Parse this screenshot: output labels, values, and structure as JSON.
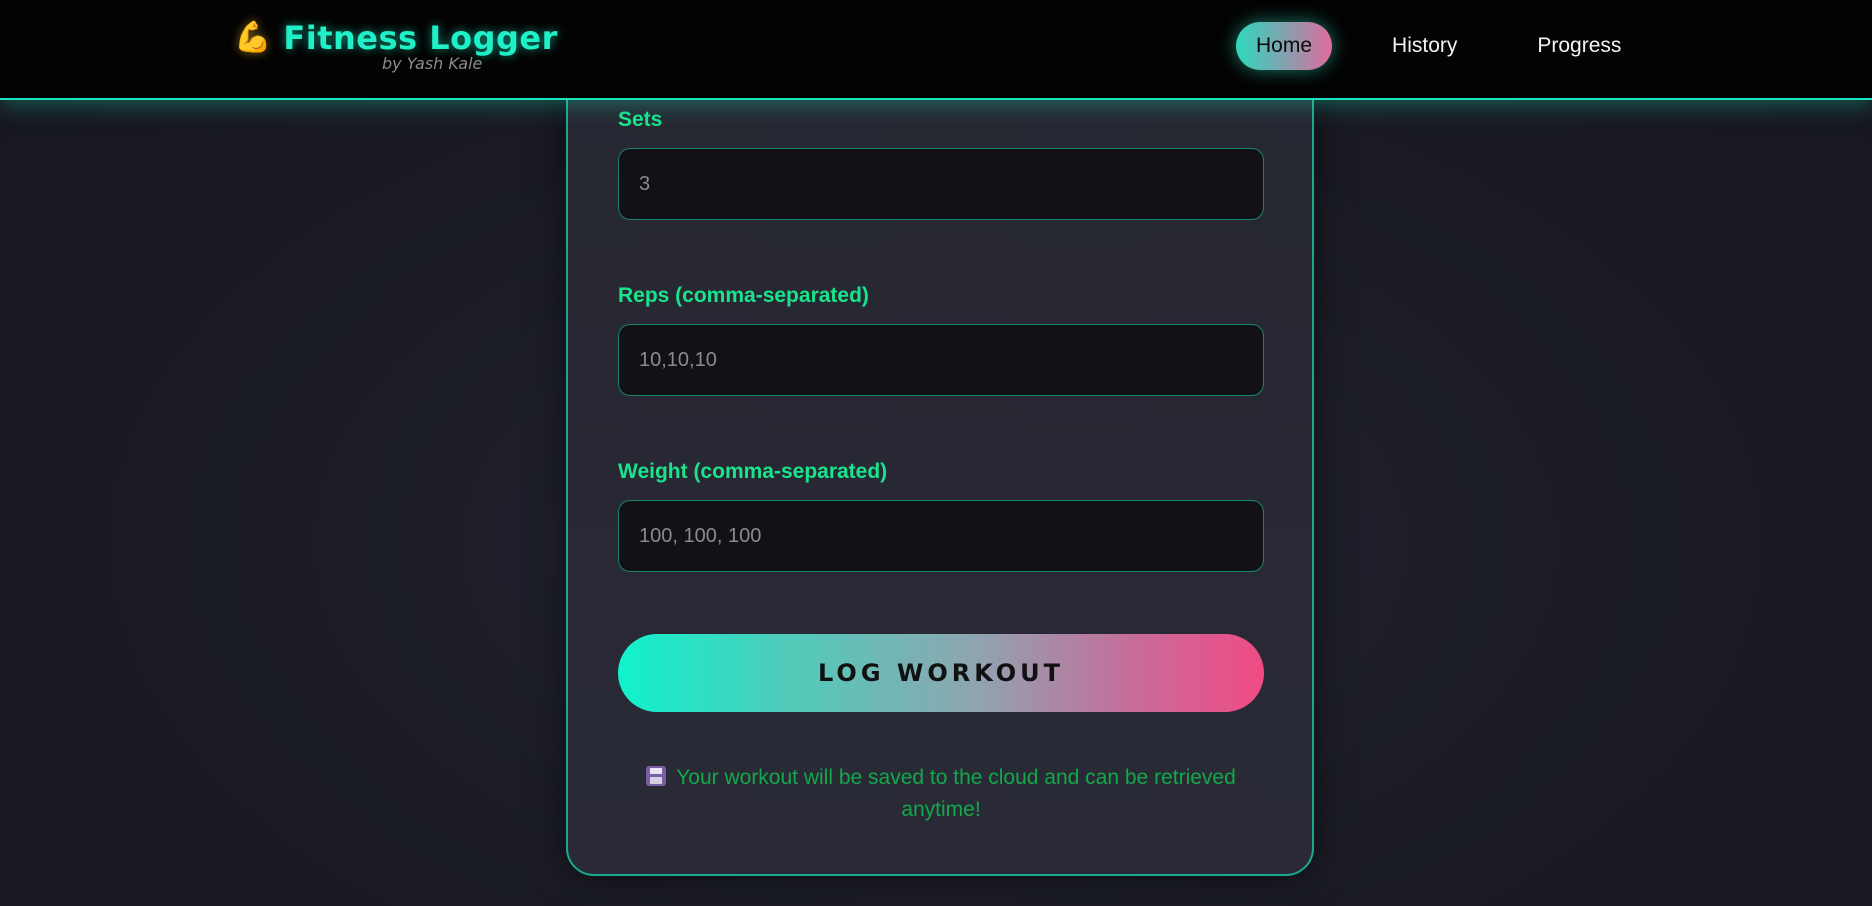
{
  "header": {
    "brand_icon": "💪",
    "brand_icon_name": "flexed-biceps-icon",
    "title": "Fitness Logger",
    "subtitle": "by Yash Kale",
    "nav": [
      {
        "label": "Home",
        "active": true
      },
      {
        "label": "History",
        "active": false
      },
      {
        "label": "Progress",
        "active": false
      }
    ]
  },
  "form": {
    "sets": {
      "label": "Sets",
      "placeholder": "3",
      "value": ""
    },
    "reps": {
      "label": "Reps (comma-separated)",
      "placeholder": "10,10,10",
      "value": ""
    },
    "weight": {
      "label": "Weight (comma-separated)",
      "placeholder": "100, 100, 100",
      "value": ""
    },
    "submit_label": "LOG WORKOUT",
    "save_icon_name": "floppy-disk-icon",
    "save_note": "Your workout will be saved to the cloud and can be retrieved anytime!"
  },
  "colors": {
    "accent": "#19e6c1",
    "label": "#19e48c",
    "note": "#13a84a",
    "button_gradient_start": "#10f2cc",
    "button_gradient_end": "#f04b84"
  }
}
